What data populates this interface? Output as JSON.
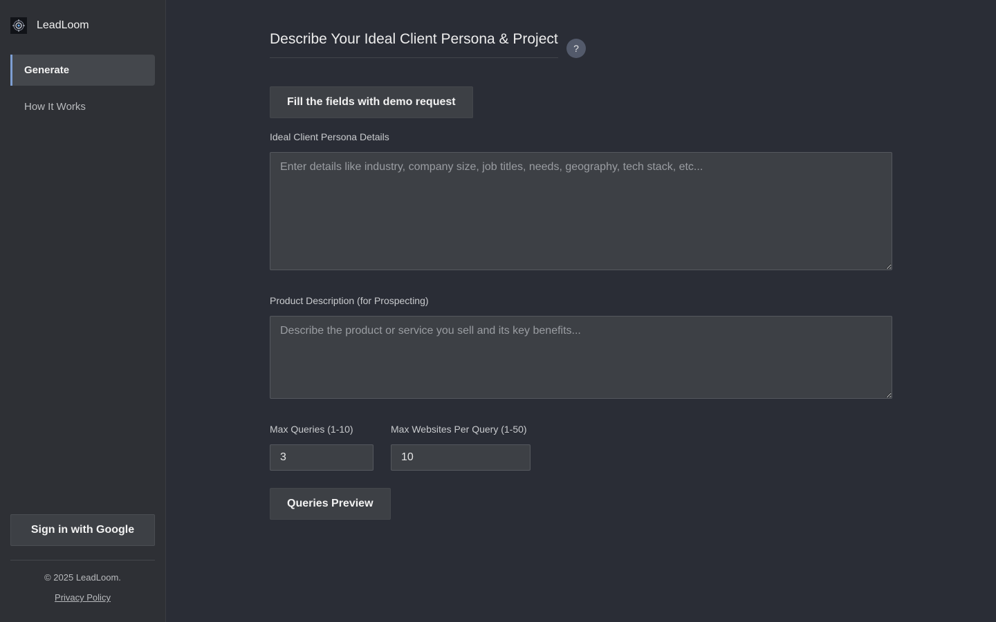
{
  "sidebar": {
    "brand_name": "LeadLoom",
    "items": [
      {
        "label": "Generate",
        "active": true
      },
      {
        "label": "How It Works",
        "active": false
      }
    ],
    "signin_label": "Sign in with Google",
    "copyright": "© 2025 LeadLoom.",
    "privacy_label": "Privacy Policy"
  },
  "main": {
    "title": "Describe Your Ideal Client Persona & Project",
    "help_label": "?",
    "demo_button": "Fill the fields with demo request",
    "persona": {
      "label": "Ideal Client Persona Details",
      "placeholder": "Enter details like industry, company size, job titles, needs, geography, tech stack, etc..."
    },
    "product": {
      "label": "Product Description (for Prospecting)",
      "placeholder": "Describe the product or service you sell and its key benefits..."
    },
    "max_queries": {
      "label": "Max Queries (1-10)",
      "value": "3"
    },
    "max_websites": {
      "label": "Max Websites Per Query (1-50)",
      "value": "10"
    },
    "preview_button": "Queries Preview"
  },
  "colors": {
    "background": "#2a2d36",
    "sidebar": "#2e3035",
    "accent": "#7e9fd3",
    "button": "#3d4045"
  },
  "icons": {
    "logo": "leadloom-logo-icon"
  }
}
